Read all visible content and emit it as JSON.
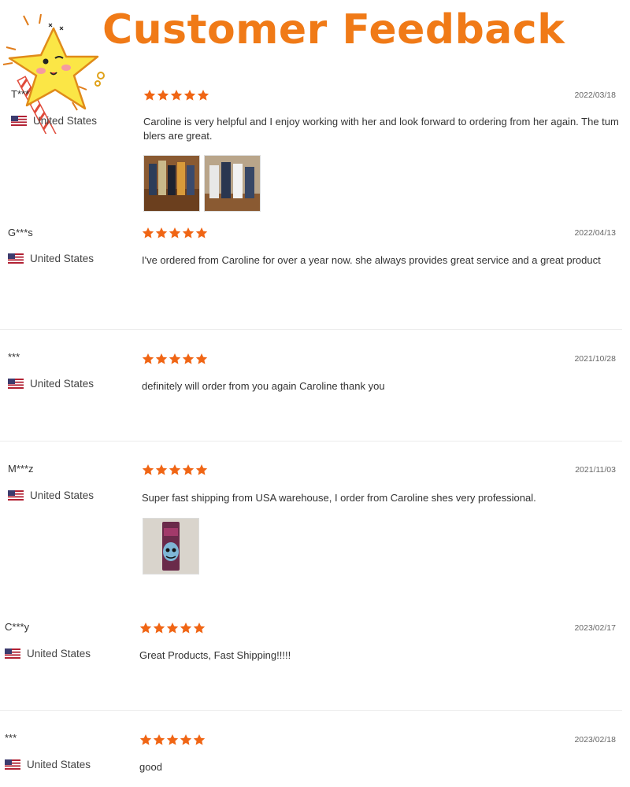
{
  "header": {
    "title": "Customer Feedback"
  },
  "colors": {
    "accent": "#f07a17",
    "star": "#f06514"
  },
  "reviews": [
    {
      "user": "T***",
      "country": "United States",
      "date": "2022/03/18",
      "rating": 5,
      "text": "Caroline is very helpful and I enjoy working with her and look forward to ordering from her again. The tumblers are great."
    },
    {
      "user": "G***s",
      "country": "United States",
      "date": "2022/04/13",
      "rating": 5,
      "text": "I've ordered from Caroline for over a year now. she always provides great service and a great product"
    },
    {
      "user": "***",
      "country": "United States",
      "date": "2021/10/28",
      "rating": 5,
      "text": "definitely will order from you again Caroline thank you"
    },
    {
      "user": "M***z",
      "country": "United States",
      "date": "2021/11/03",
      "rating": 5,
      "text": "Super fast shipping from USA warehouse, I order from Caroline shes very professional."
    },
    {
      "user": "C***y",
      "country": "United States",
      "date": "2023/02/17",
      "rating": 5,
      "text": "Great Products, Fast Shipping!!!!!"
    },
    {
      "user": "***",
      "country": "United States",
      "date": "2023/02/18",
      "rating": 5,
      "text": "good"
    }
  ]
}
